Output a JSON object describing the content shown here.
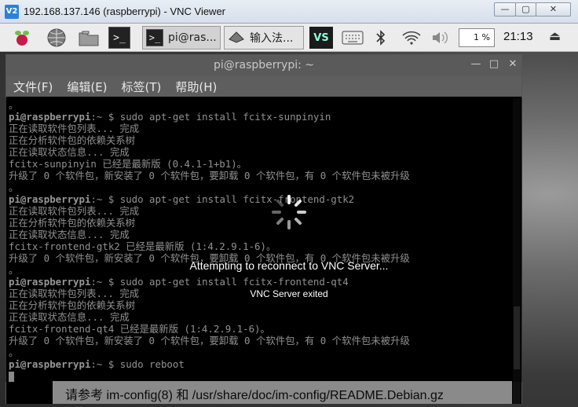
{
  "window": {
    "logo": "V2",
    "title": "192.168.137.146 (raspberrypi) - VNC Viewer",
    "min_glyph": "—",
    "max_glyph": "▢",
    "close_glyph": "✕"
  },
  "taskbar": {
    "terminal_glyph": ">_",
    "tasks": [
      {
        "label": "pi@ras..."
      },
      {
        "label": "输入法..."
      }
    ],
    "tray_vs_label": "VS",
    "cpu": "1 %",
    "clock": "21:13"
  },
  "terminal": {
    "title": "pi@raspberrypi: ~",
    "menu": [
      "文件(F)",
      "编辑(E)",
      "标签(T)",
      "帮助(H)"
    ],
    "lines": [
      {
        "user": "",
        "text": "。"
      },
      {
        "user": "pi@raspberrypi",
        "text": ":~ $ sudo apt-get install fcitx-sunpinyin"
      },
      {
        "user": "",
        "text": "正在读取软件包列表... 完成"
      },
      {
        "user": "",
        "text": "正在分析软件包的依赖关系树"
      },
      {
        "user": "",
        "text": "正在读取状态信息... 完成"
      },
      {
        "user": "",
        "text": "fcitx-sunpinyin 已经是最新版 (0.4.1-1+b1)。"
      },
      {
        "user": "",
        "text": "升级了 0 个软件包，新安装了 0 个软件包，要卸载 0 个软件包，有 0 个软件包未被升级"
      },
      {
        "user": "",
        "text": "。"
      },
      {
        "user": "pi@raspberrypi",
        "text": ":~ $ sudo apt-get install fcitx-frontend-gtk2"
      },
      {
        "user": "",
        "text": "正在读取软件包列表... 完成"
      },
      {
        "user": "",
        "text": "正在分析软件包的依赖关系树"
      },
      {
        "user": "",
        "text": "正在读取状态信息... 完成"
      },
      {
        "user": "",
        "text": "fcitx-frontend-gtk2 已经是最新版 (1:4.2.9.1-6)。"
      },
      {
        "user": "",
        "text": "升级了 0 个软件包，新安装了 0 个软件包，要卸载 0 个软件包，有 0 个软件包未被升级"
      },
      {
        "user": "",
        "text": "。"
      },
      {
        "user": "pi@raspberrypi",
        "text": ":~ $ sudo apt-get install fcitx-frontend-qt4"
      },
      {
        "user": "",
        "text": "正在读取软件包列表... 完成"
      },
      {
        "user": "",
        "text": "正在分析软件包的依赖关系树"
      },
      {
        "user": "",
        "text": "正在读取状态信息... 完成"
      },
      {
        "user": "",
        "text": "fcitx-frontend-qt4 已经是最新版 (1:4.2.9.1-6)。"
      },
      {
        "user": "",
        "text": "升级了 0 个软件包，新安装了 0 个软件包，要卸载 0 个软件包，有 0 个软件包未被升级"
      },
      {
        "user": "",
        "text": "。"
      },
      {
        "user": "pi@raspberrypi",
        "text": ":~ $ sudo reboot"
      },
      {
        "user": "",
        "text": ""
      }
    ]
  },
  "overlay": {
    "reconnect": "Attempting to reconnect to VNC Server...",
    "exited": "VNC Server exited"
  },
  "notice": "请参考 im-config(8) 和 /usr/share/doc/im-config/README.Debian.gz"
}
